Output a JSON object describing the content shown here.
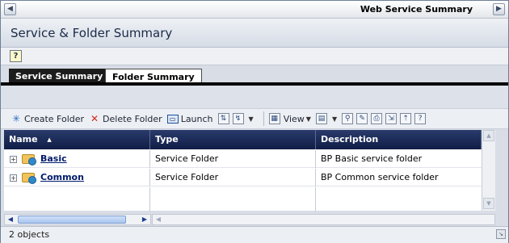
{
  "window": {
    "title": "Web Service Summary",
    "left_btn": "◀",
    "right_btn": "▶"
  },
  "header": {
    "title": "Service & Folder Summary",
    "help": "?"
  },
  "tabs": [
    {
      "label": "Service Summary",
      "active": false
    },
    {
      "label": "Folder Summary",
      "active": true
    }
  ],
  "toolbar": {
    "create_folder": "Create Folder",
    "delete_folder": "Delete Folder",
    "launch": "Launch",
    "view": "View",
    "help": "?"
  },
  "table": {
    "columns": [
      "Name",
      "Type",
      "Description"
    ],
    "rows": [
      {
        "name": "Basic",
        "type": "Service Folder",
        "description": "BP Basic service folder"
      },
      {
        "name": "Common",
        "type": "Service Folder",
        "description": "BP Common service folder"
      }
    ]
  },
  "status": {
    "text": "2 objects"
  }
}
